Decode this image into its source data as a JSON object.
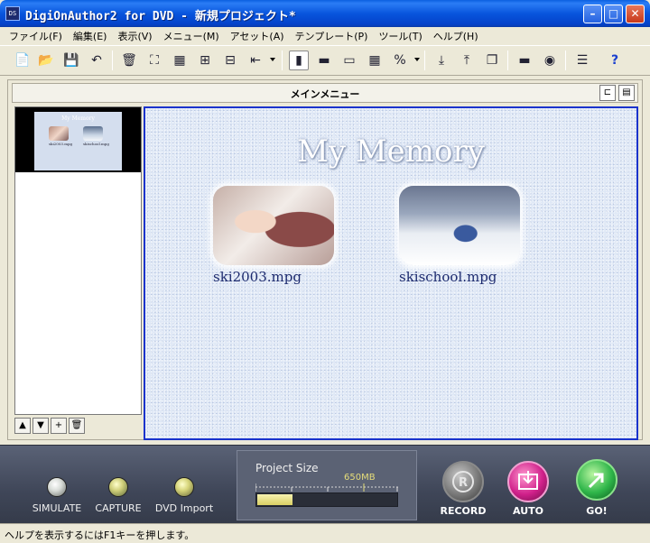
{
  "window": {
    "title": "DigiOnAuthor2 for DVD - 新規プロジェクト*",
    "app_icon_text": "DS",
    "minimize_glyph": "–",
    "maximize_glyph": "□",
    "close_glyph": "✕"
  },
  "menu": [
    {
      "label": "ファイル(F)"
    },
    {
      "label": "編集(E)"
    },
    {
      "label": "表示(V)"
    },
    {
      "label": "メニュー(M)"
    },
    {
      "label": "アセット(A)"
    },
    {
      "label": "テンプレート(P)"
    },
    {
      "label": "ツール(T)"
    },
    {
      "label": "ヘルプ(H)"
    }
  ],
  "toolbar": {
    "new_icon": "📄",
    "open_icon": "📂",
    "save_icon": "💾",
    "undo_icon": "↶",
    "delete_icon": "🗑",
    "fit_icon": "⛶",
    "grid_icon": "▦",
    "group_icon": "⊞",
    "ungroup_icon": "⊟",
    "align_icon": "⇤",
    "layout_vertical_icon": "▮",
    "layout_strip_icon": "▬",
    "layout_single_icon": "▭",
    "layout_table_icon": "▦",
    "percent_icon": "%",
    "import_icon": "⤓",
    "export_icon": "⤒",
    "stack_icon": "❐",
    "drive_icon": "▬",
    "disc_icon": "◉",
    "settings_icon": "☰",
    "help_icon": "?"
  },
  "panel": {
    "title": "メインメニュー",
    "btn_a": "⊏",
    "btn_b": "▤"
  },
  "thumbnail": {
    "title": "My Memory",
    "item1": "ski2003.mpg",
    "item2": "skischool.mpg"
  },
  "thumb_tools": [
    {
      "label": "▲"
    },
    {
      "label": "▼"
    },
    {
      "label": "+"
    },
    {
      "label": "🗑"
    }
  ],
  "preview": {
    "title": "My Memory",
    "items": [
      {
        "label": "ski2003.mpg"
      },
      {
        "label": "skischool.mpg"
      }
    ]
  },
  "controls": {
    "simulate": "SIMULATE",
    "capture": "CAPTURE",
    "dvd_import": "DVD Import",
    "project_size_label": "Project Size",
    "capacity_mark": "650MB",
    "project_size_fill": 0.25,
    "record": "RECORD",
    "auto": "AUTO",
    "go": "GO!"
  },
  "status": {
    "text": "ヘルプを表示するにはF1キーを押します。"
  },
  "colors": {
    "title_blue": "#0a5fe0",
    "preview_border": "#1a33cc",
    "auto_pink": "#d0208a",
    "go_green": "#2fb64a"
  }
}
